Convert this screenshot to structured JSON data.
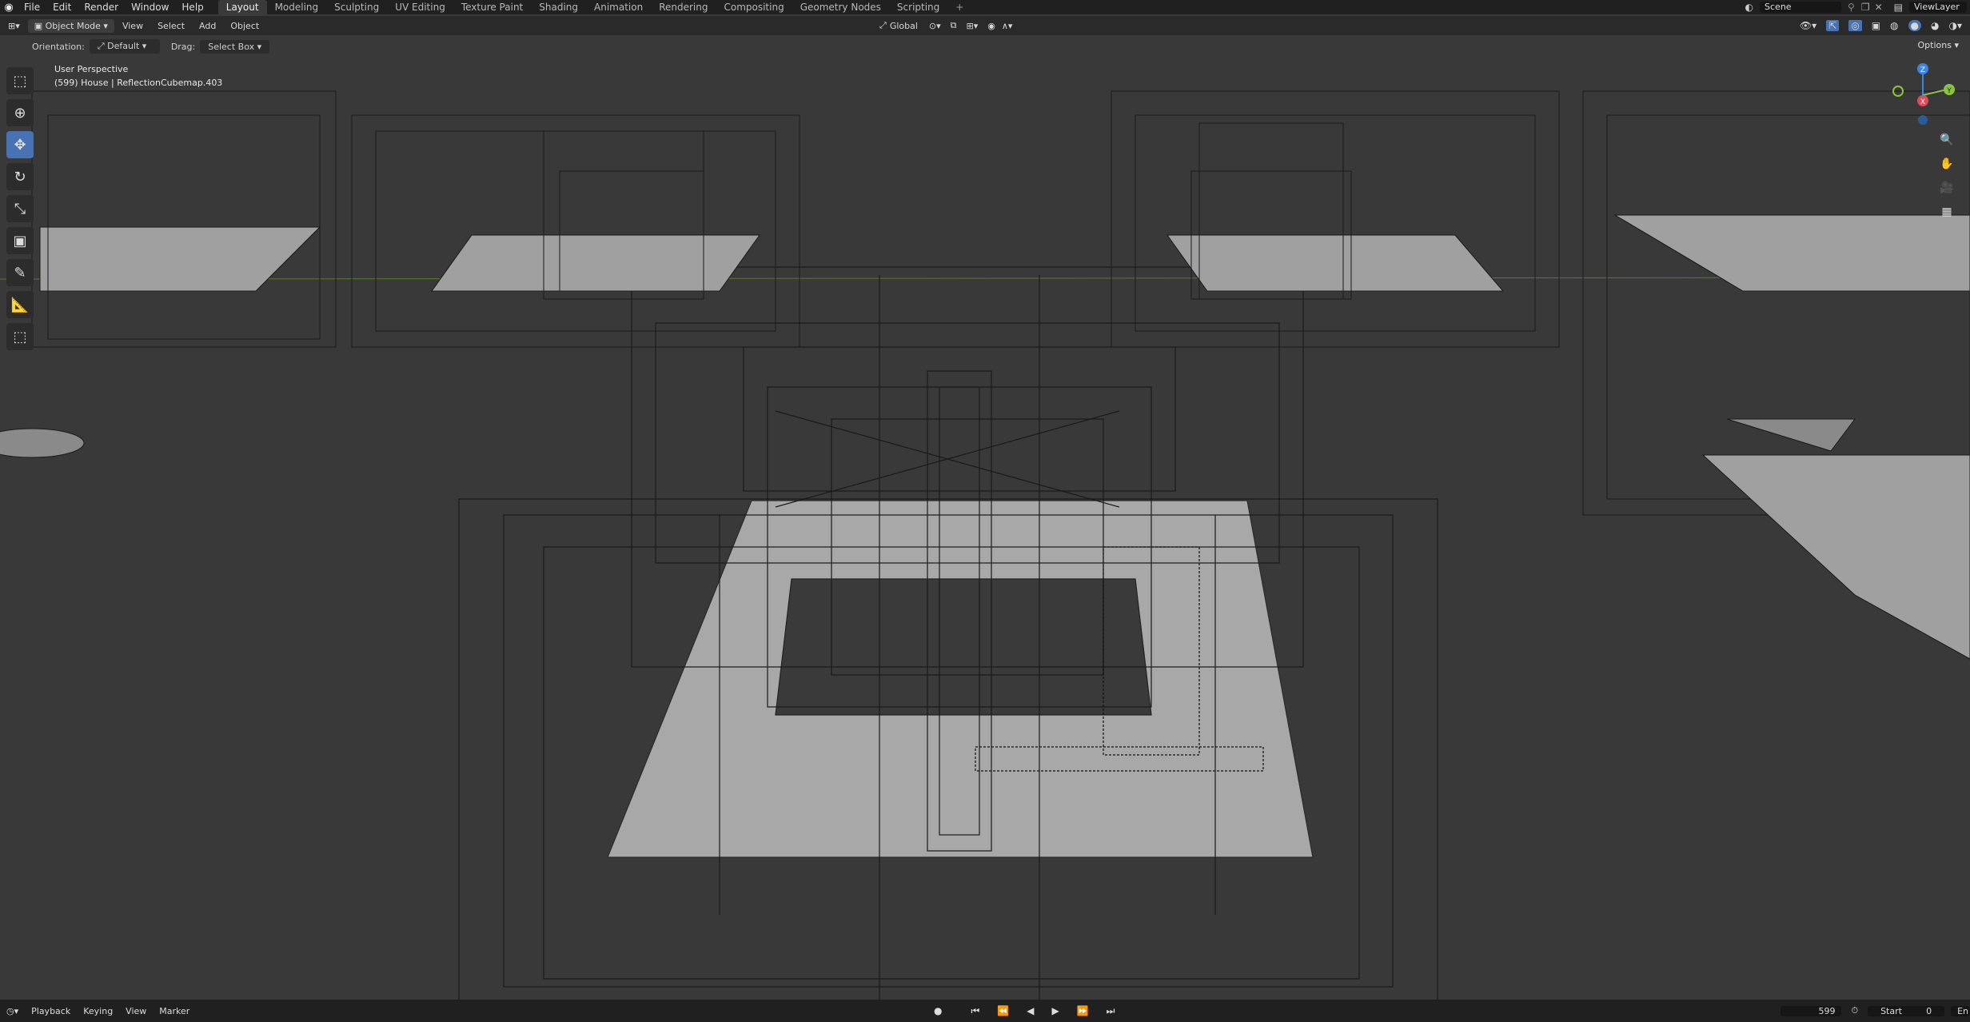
{
  "topbar": {
    "menu": [
      "File",
      "Edit",
      "Render",
      "Window",
      "Help"
    ],
    "tabs": [
      "Layout",
      "Modeling",
      "Sculpting",
      "UV Editing",
      "Texture Paint",
      "Shading",
      "Animation",
      "Rendering",
      "Compositing",
      "Geometry Nodes",
      "Scripting"
    ],
    "active_tab": "Layout",
    "scene": "Scene",
    "view_layer": "ViewLayer"
  },
  "header": {
    "mode": "Object Mode",
    "items": [
      "View",
      "Select",
      "Add",
      "Object"
    ],
    "transform_orientation": "Global",
    "options": "Options"
  },
  "tool_header": {
    "orientation_label": "Orientation:",
    "orientation_value": "Default",
    "drag_label": "Drag:",
    "drag_value": "Select Box"
  },
  "viewport": {
    "perspective": "User Perspective",
    "active_object": "(599) House | ReflectionCubemap.403"
  },
  "gizmo": {
    "x": "X",
    "y": "Y",
    "z": "Z"
  },
  "timeline": {
    "items": [
      "Playback",
      "Keying",
      "View",
      "Marker"
    ],
    "current_frame": "599",
    "start_label": "Start",
    "start_value": "0",
    "end_label": "En"
  },
  "colors": {
    "accent": "#4772b3",
    "x_axis": "#e04a5c",
    "y_axis": "#8bc53f",
    "z_axis": "#3d86e0"
  }
}
